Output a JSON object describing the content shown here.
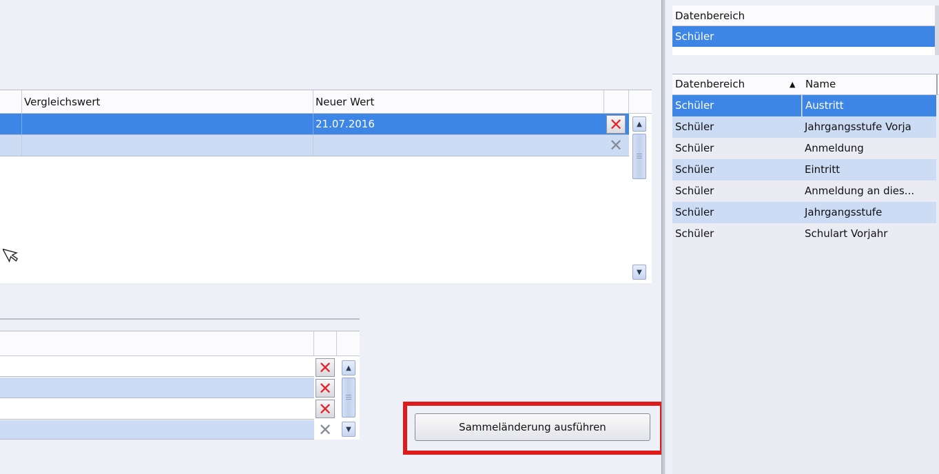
{
  "top_grid": {
    "columns": [
      "Vergleichswert",
      "Neuer Wert"
    ],
    "rows": [
      {
        "vergleichswert": "",
        "neuer_wert": "21.07.2016",
        "selected": true
      },
      {
        "vergleichswert": "",
        "neuer_wert": "",
        "selected": false
      }
    ]
  },
  "bottom_grid": {
    "rows": [
      {
        "value": ""
      },
      {
        "value": ""
      },
      {
        "value": ""
      },
      {
        "value": ""
      }
    ]
  },
  "action_button": {
    "label": "Sammeländerung ausführen"
  },
  "right_top": {
    "header": "Datenbereich",
    "rows": [
      "Schüler"
    ]
  },
  "right_list": {
    "columns": [
      "Datenbereich",
      "Name"
    ],
    "sort_indicator": "▲",
    "rows": [
      {
        "datenbereich": "Schüler",
        "name": "Austritt"
      },
      {
        "datenbereich": "Schüler",
        "name": "Jahrgangsstufe Vorja"
      },
      {
        "datenbereich": "Schüler",
        "name": "Anmeldung"
      },
      {
        "datenbereich": "Schüler",
        "name": "Eintritt"
      },
      {
        "datenbereich": "Schüler",
        "name": "Anmeldung an dies..."
      },
      {
        "datenbereich": "Schüler",
        "name": "Jahrgangsstufe"
      },
      {
        "datenbereich": "Schüler",
        "name": "Schulart Vorjahr"
      }
    ]
  },
  "colors": {
    "selection": "#3d86e6",
    "alt_row": "#cddcf5",
    "highlight_frame": "#e01919",
    "delete_icon": "#e8222a"
  },
  "icons": {
    "delete": "delete-x-icon",
    "scroll_up": "chevron-up-icon",
    "scroll_down": "chevron-down-icon",
    "cursor": "mouse-cursor-icon"
  }
}
